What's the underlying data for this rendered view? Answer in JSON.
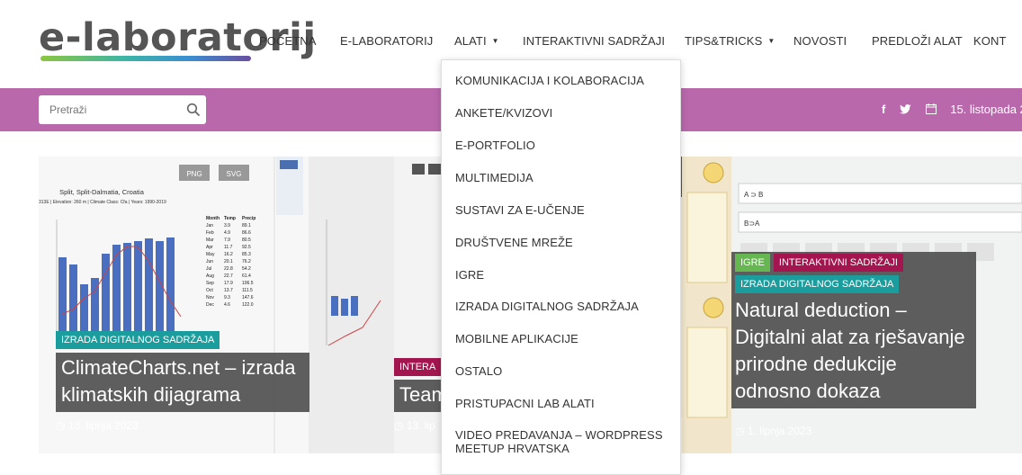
{
  "brand": {
    "logo_text": "e-laboratorij"
  },
  "nav": [
    {
      "label": "POČETNA"
    },
    {
      "label": "E-LABORATORIJ"
    },
    {
      "label": "ALATI",
      "has_caret": true
    },
    {
      "label": "INTERAKTIVNI SADRŽAJI"
    },
    {
      "label": "TIPS&TRICKS",
      "has_caret": true
    },
    {
      "label": "NOVOSTI"
    },
    {
      "label": "PREDLOŽI ALAT"
    },
    {
      "label": "KONT"
    }
  ],
  "search": {
    "placeholder": "Pretraži"
  },
  "topbar": {
    "date": "15. listopada 2"
  },
  "dropdown": {
    "items": [
      "KOMUNIKACIJA I KOLABORACIJA",
      "ANKETE/KVIZOVI",
      "E-PORTFOLIO",
      "MULTIMEDIJA",
      "SUSTAVI ZA E-UČENJE",
      "DRUŠTVENE MREŽE",
      "IGRE",
      "IZRADA DIGITALNOG SADRŽAJA",
      "MOBILNE APLIKACIJE",
      "OSTALO",
      "PRISTUPACNI LAB ALATI",
      "VIDEO PREDAVANJA – WORDPRESS",
      "MEETUP HRVATSKA"
    ]
  },
  "cards": [
    {
      "tags": [
        "IZRADA DIGITALNOG SADRŽAJA"
      ],
      "title_lines": [
        "ClimateCharts.net – izrada",
        "klimatskih dijagrama"
      ],
      "date": "13. lipnja 2023"
    },
    {
      "tags": [
        "INTERA"
      ],
      "title_lines": [
        "Team"
      ],
      "date": "13. lip"
    },
    {
      "tags": [
        "IGRE",
        "INTERAKTIVNI SADRŽAJI",
        "IZRADA DIGITALNOG SADRŽAJA"
      ],
      "title_lines": [
        "Natural deduction –",
        "Digitalni alat za rješavanje",
        "prirodne dedukcije",
        "odnosno dokaza"
      ],
      "date": "1. lipnja 2023"
    }
  ],
  "thumb1": {
    "buttons": [
      "PNG",
      "SVG"
    ],
    "heading": "Split, Split-Dalmatia, Croatia",
    "subheading": "313E | Elevation: 260 m | Climate Class: Cfa | Years: 1990-2019",
    "table_header": [
      "Month",
      "Temp",
      "Precip"
    ],
    "table_rows": [
      [
        "Jan",
        "3.9",
        "89.1"
      ],
      [
        "Feb",
        "4.9",
        "86.6"
      ],
      [
        "Mar",
        "7.9",
        "80.5"
      ],
      [
        "Apr",
        "11.7",
        "92.5"
      ],
      [
        "May",
        "16.2",
        "85.3"
      ],
      [
        "Jun",
        "20.1",
        "76.2"
      ],
      [
        "Jul",
        "22.8",
        "54.2"
      ],
      [
        "Aug",
        "22.7",
        "61.4"
      ],
      [
        "Sep",
        "17.9",
        "106.5"
      ],
      [
        "Oct",
        "13.7",
        "111.5"
      ],
      [
        "Nov",
        "9.3",
        "147.6"
      ],
      [
        "Dec",
        "4.6",
        "122.0"
      ]
    ]
  },
  "thumb3": {
    "rows": [
      "A ⊃ B",
      "B⊃A"
    ]
  },
  "colors": {
    "band": "#b968ac",
    "tag_teal": "#1b9d9d",
    "tag_green": "#66b752",
    "tag_maroon": "#a3154f"
  }
}
